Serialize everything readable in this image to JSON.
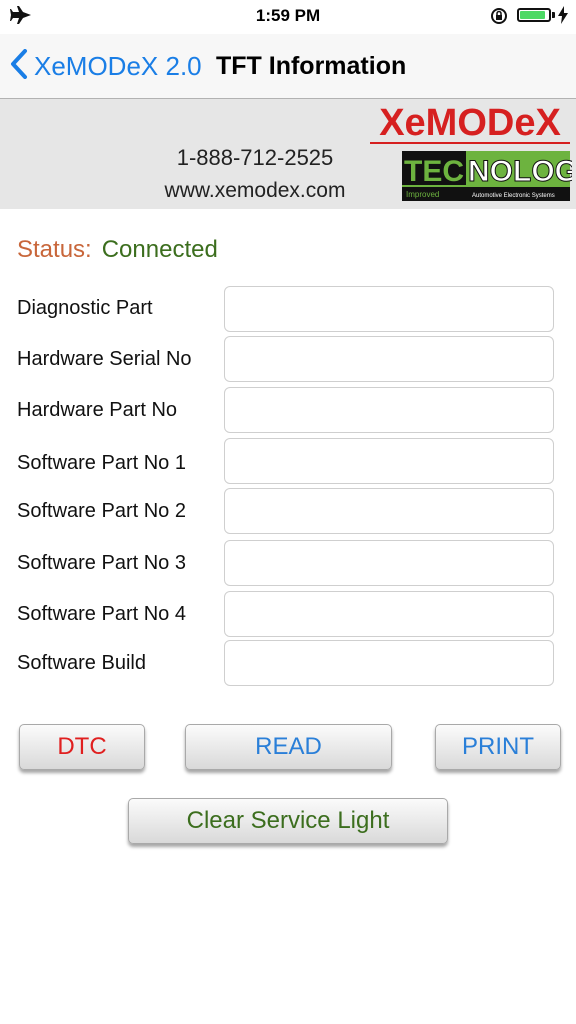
{
  "status_bar": {
    "time": "1:59 PM",
    "battery_level": 0.9,
    "icons": [
      "airplane-icon",
      "rotation-lock-icon",
      "battery-icon",
      "charging-bolt-icon"
    ]
  },
  "nav": {
    "back_label": "XeMODeX 2.0",
    "title": "TFT Information",
    "accent_color": "#1a7ee6"
  },
  "banner": {
    "phone": "1-888-712-2525",
    "website": "www.xemodex.com",
    "logo": {
      "brand": "XeMODeX",
      "word_left": "TECH",
      "word_right": "NOLOGY",
      "tagline_left": "Improved",
      "tagline_right": "Automotive Electronic Systems"
    }
  },
  "status": {
    "label": "Status:",
    "value": "Connected",
    "label_color": "#c8663a",
    "value_color": "#3c6e1e"
  },
  "fields": [
    {
      "label": "Diagnostic Part",
      "value": ""
    },
    {
      "label": "Hardware Serial No",
      "value": ""
    },
    {
      "label": "Hardware Part No",
      "value": ""
    },
    {
      "label": "Software Part No 1",
      "value": ""
    },
    {
      "label": "Software Part No 2",
      "value": ""
    },
    {
      "label": "Software Part No 3",
      "value": ""
    },
    {
      "label": "Software Part No 4",
      "value": ""
    },
    {
      "label": "Software Build",
      "value": ""
    }
  ],
  "buttons": {
    "dtc": "DTC",
    "read": "READ",
    "print": "PRINT",
    "clear_service_light": "Clear Service Light"
  }
}
